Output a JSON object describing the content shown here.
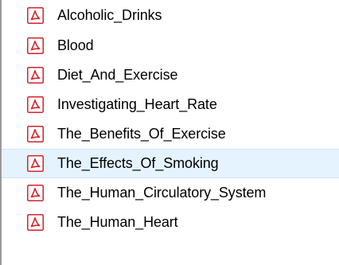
{
  "colors": {
    "icon_red": "#d4232b",
    "hover_background": "#e5f3ff",
    "hover_border": "#cce8ff",
    "text": "#000000"
  },
  "file_list": {
    "icon": "pdf-file-icon",
    "hovered_index": 5,
    "items": [
      {
        "name": "Alcoholic_Drinks"
      },
      {
        "name": "Blood"
      },
      {
        "name": "Diet_And_Exercise"
      },
      {
        "name": "Investigating_Heart_Rate"
      },
      {
        "name": "The_Benefits_Of_Exercise"
      },
      {
        "name": "The_Effects_Of_Smoking"
      },
      {
        "name": "The_Human_Circulatory_System"
      },
      {
        "name": "The_Human_Heart"
      }
    ]
  }
}
